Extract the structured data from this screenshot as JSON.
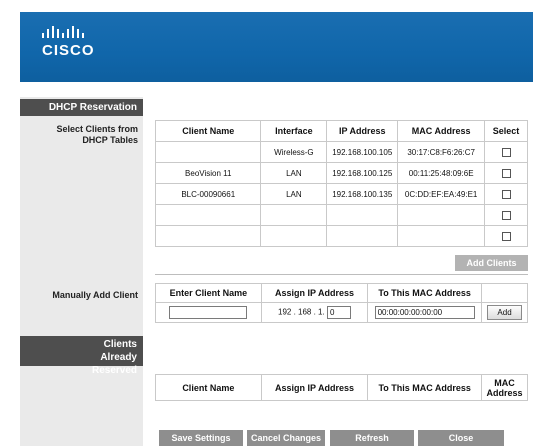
{
  "brand": {
    "logo_text": "CISCO"
  },
  "sections": {
    "dhcp_reservation": "DHCP Reservation",
    "select_clients_label": "Select Clients from DHCP Tables",
    "manually_add_label": "Manually Add Client",
    "clients_reserved": "Clients Already Reserved"
  },
  "dhcp_table": {
    "headers": [
      "Client Name",
      "Interface",
      "IP Address",
      "MAC Address",
      "Select"
    ],
    "rows": [
      [
        "",
        "Wireless-G",
        "192.168.100.105",
        "30:17:C8:F6:26:C7"
      ],
      [
        "BeoVision 11",
        "LAN",
        "192.168.100.125",
        "00:11:25:48:09:6E"
      ],
      [
        "BLC-00090661",
        "LAN",
        "192.168.100.135",
        "0C:DD:EF:EA:49:E1"
      ],
      [
        "",
        "",
        "",
        ""
      ],
      [
        "",
        "",
        "",
        ""
      ]
    ]
  },
  "add_clients_button": "Add Clients",
  "manual_table": {
    "headers": [
      "Enter Client Name",
      "Assign IP Address",
      "To This MAC Address"
    ],
    "ip_prefix": "192 . 168 . 1.",
    "ip_value": "0",
    "mac_value": "00:00:00:00:00:00",
    "client_name_value": "",
    "add_button": "Add"
  },
  "reserved_table": {
    "headers": [
      "Client Name",
      "Assign IP Address",
      "To This MAC Address",
      "MAC Address"
    ]
  },
  "footer": {
    "save": "Save Settings",
    "cancel": "Cancel Changes",
    "refresh": "Refresh",
    "close": "Close"
  }
}
